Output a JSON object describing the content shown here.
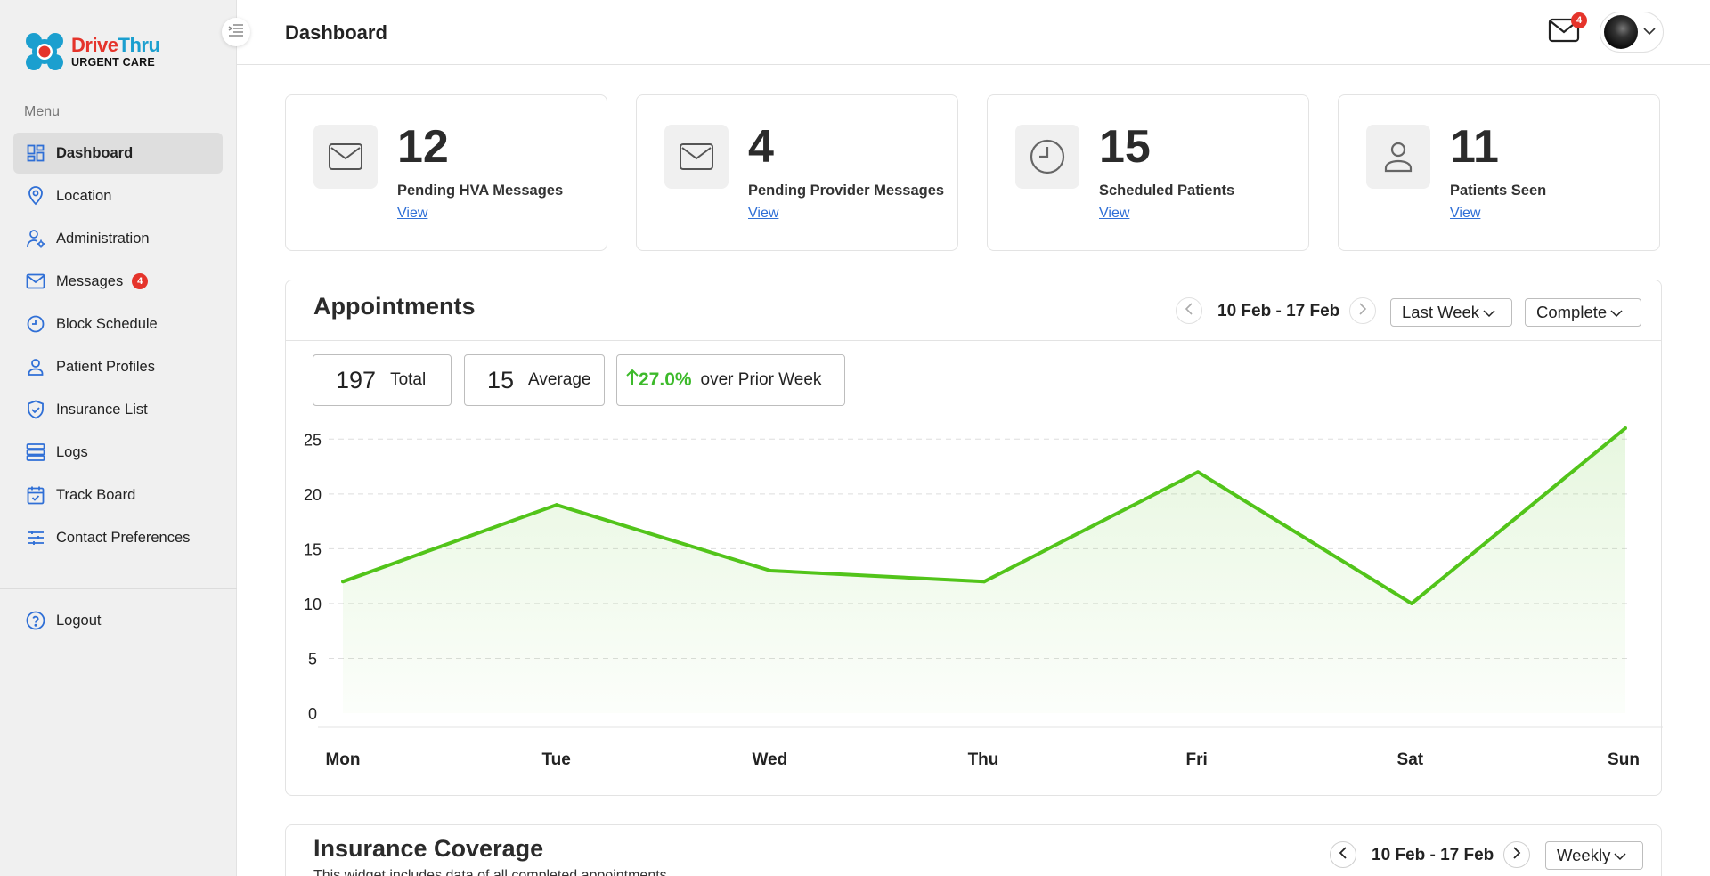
{
  "brand": {
    "name_part1": "Drive",
    "name_part2": "Thru",
    "tagline": "URGENT CARE",
    "colors": {
      "red": "#e5342b",
      "blue": "#1b9fcf"
    }
  },
  "sidebar": {
    "menu_title": "Menu",
    "items": [
      {
        "label": "Dashboard",
        "icon": "dashboard-icon",
        "active": true
      },
      {
        "label": "Location",
        "icon": "location-pin-icon"
      },
      {
        "label": "Administration",
        "icon": "user-gear-icon"
      },
      {
        "label": "Messages",
        "icon": "mail-icon",
        "badge": "4"
      },
      {
        "label": "Block Schedule",
        "icon": "clock-icon"
      },
      {
        "label": "Patient Profiles",
        "icon": "user-icon"
      },
      {
        "label": "Insurance List",
        "icon": "shield-check-icon"
      },
      {
        "label": "Logs",
        "icon": "server-icon"
      },
      {
        "label": "Track Board",
        "icon": "calendar-check-icon"
      },
      {
        "label": "Contact Preferences",
        "icon": "sliders-icon"
      }
    ],
    "logout_label": "Logout"
  },
  "header": {
    "title": "Dashboard",
    "mail_badge": "4"
  },
  "stats": [
    {
      "value": "12",
      "label": "Pending HVA Messages",
      "link": "View",
      "icon": "mail-icon"
    },
    {
      "value": "4",
      "label": "Pending Provider Messages",
      "link": "View",
      "icon": "mail-icon"
    },
    {
      "value": "15",
      "label": "Scheduled Patients",
      "link": "View",
      "icon": "clock-icon"
    },
    {
      "value": "11",
      "label": "Patients Seen",
      "link": "View",
      "icon": "user-icon"
    }
  ],
  "appointments": {
    "title": "Appointments",
    "date_range": "10 Feb - 17 Feb",
    "period_select": "Last Week",
    "status_select": "Complete",
    "total_value": "197",
    "total_label": "Total",
    "average_value": "15",
    "average_label": "Average",
    "change_value": "27.0%",
    "change_label": "over Prior Week"
  },
  "insurance": {
    "title": "Insurance Coverage",
    "subtitle": "This widget includes data of all completed appointments",
    "date_range": "10 Feb - 17 Feb",
    "period_select": "Weekly"
  },
  "chart_data": {
    "type": "area",
    "categories": [
      "Mon",
      "Tue",
      "Wed",
      "Thu",
      "Fri",
      "Sat",
      "Sun"
    ],
    "values": [
      12,
      19,
      13,
      12,
      22,
      10,
      26
    ],
    "yticks": [
      0,
      5,
      10,
      15,
      20,
      25
    ],
    "ylim": [
      0,
      26
    ],
    "grid": true,
    "line_color": "#52c41a",
    "fill_color": "#e9f9e4"
  }
}
